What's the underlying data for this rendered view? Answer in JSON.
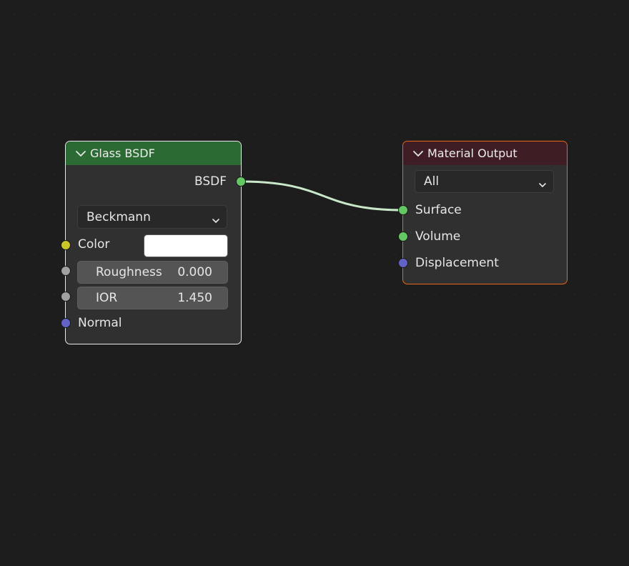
{
  "nodes": {
    "glass_bsdf": {
      "title": "Glass BSDF",
      "output_label": "BSDF",
      "distribution": "Beckmann",
      "inputs": {
        "color": {
          "label": "Color",
          "value": "#ffffff"
        },
        "roughness": {
          "label": "Roughness",
          "value": "0.000"
        },
        "ior": {
          "label": "IOR",
          "value": "1.450"
        },
        "normal": {
          "label": "Normal"
        }
      }
    },
    "material_output": {
      "title": "Material Output",
      "target": "All",
      "inputs": {
        "surface": "Surface",
        "volume": "Volume",
        "displacement": "Displacement"
      }
    }
  },
  "colors": {
    "background": "#1d1d1d",
    "node_body": "#303030",
    "shader_header": "#2c6a33",
    "output_header": "#3e1d25",
    "selected_border": "#e8e8e8",
    "active_border": "#e8681a",
    "link": "#c9e8c9",
    "socket_shader": "#63c763",
    "socket_color": "#c7c729",
    "socket_float": "#a1a1a1",
    "socket_vector": "#6363c7"
  }
}
